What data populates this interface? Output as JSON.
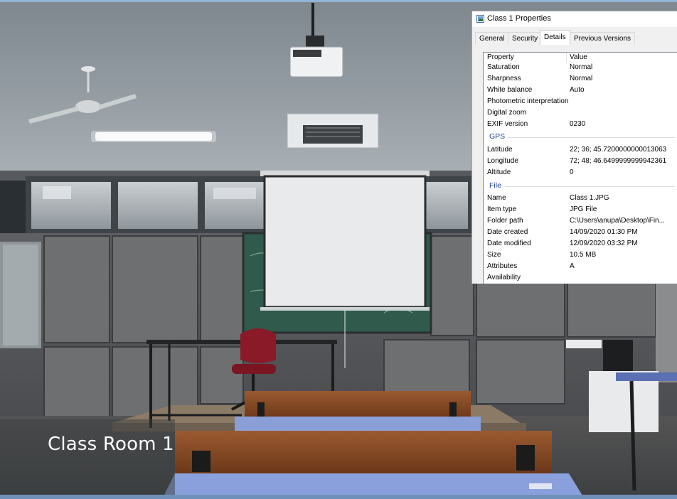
{
  "caption": "Class Room 1",
  "properties_window": {
    "title": "Class 1 Properties",
    "tabs": [
      {
        "label": "General",
        "active": false
      },
      {
        "label": "Security",
        "active": false
      },
      {
        "label": "Details",
        "active": true
      },
      {
        "label": "Previous Versions",
        "active": false
      }
    ],
    "header": {
      "property": "Property",
      "value": "Value"
    },
    "rows_top": [
      {
        "property": "Saturation",
        "value": "Normal"
      },
      {
        "property": "Sharpness",
        "value": "Normal"
      },
      {
        "property": "White balance",
        "value": "Auto"
      },
      {
        "property": "Photometric interpretation",
        "value": ""
      },
      {
        "property": "Digital zoom",
        "value": ""
      },
      {
        "property": "EXIF version",
        "value": "0230"
      }
    ],
    "group_gps": "GPS",
    "rows_gps": [
      {
        "property": "Latitude",
        "value": "22; 36; 45.7200000000013063"
      },
      {
        "property": "Longitude",
        "value": "72; 48; 46.6499999999942361"
      },
      {
        "property": "Altitude",
        "value": "0"
      }
    ],
    "group_file": "File",
    "rows_file": [
      {
        "property": "Name",
        "value": "Class 1.JPG"
      },
      {
        "property": "Item type",
        "value": "JPG File"
      },
      {
        "property": "Folder path",
        "value": "C:\\Users\\anupa\\Desktop\\Fin..."
      },
      {
        "property": "Date created",
        "value": "14/09/2020 01:30 PM"
      },
      {
        "property": "Date modified",
        "value": "12/09/2020 03:32 PM"
      },
      {
        "property": "Size",
        "value": "10.5 MB"
      },
      {
        "property": "Attributes",
        "value": "A"
      },
      {
        "property": "Availability",
        "value": ""
      }
    ]
  },
  "colors": {
    "accent_group": "#1e3f8c",
    "chair": "#8a1a28",
    "bench_top": "#8a9ed8",
    "bench_wood": "#8a4a26"
  }
}
